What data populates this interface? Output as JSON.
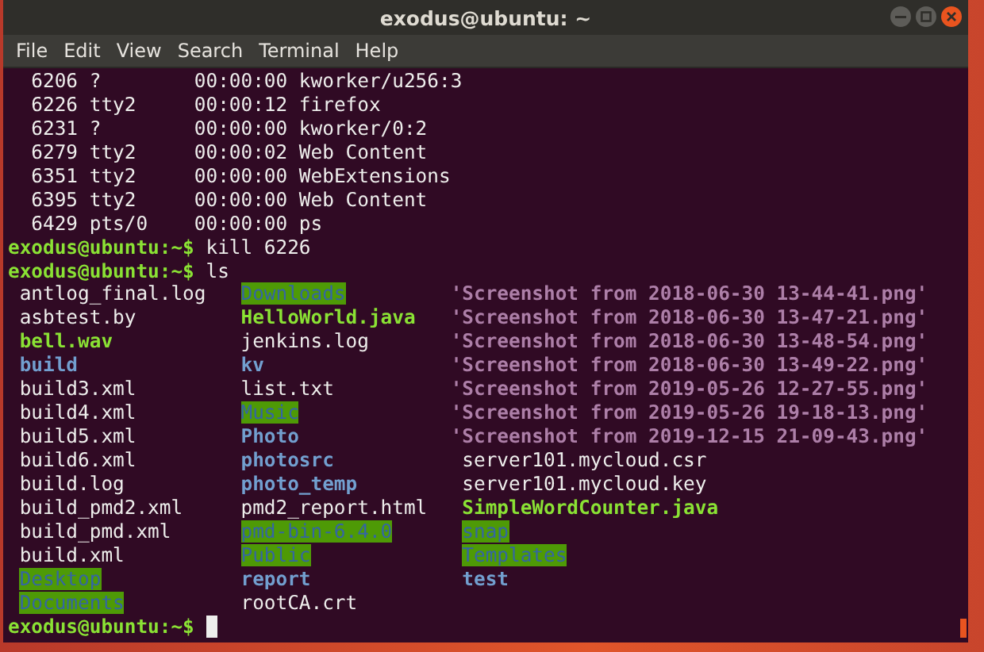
{
  "window": {
    "title": "exodus@ubuntu: ~"
  },
  "menu": [
    "File",
    "Edit",
    "View",
    "Search",
    "Terminal",
    "Help"
  ],
  "lines": [
    {
      "kind": "output",
      "text": "  6206 ?        00:00:00 kworker/u256:3"
    },
    {
      "kind": "output",
      "text": "  6226 tty2     00:00:12 firefox"
    },
    {
      "kind": "output",
      "text": "  6231 ?        00:00:00 kworker/0:2"
    },
    {
      "kind": "output",
      "text": "  6279 tty2     00:00:02 Web Content"
    },
    {
      "kind": "output",
      "text": "  6351 tty2     00:00:00 WebExtensions"
    },
    {
      "kind": "output",
      "text": "  6395 tty2     00:00:00 Web Content"
    },
    {
      "kind": "output",
      "text": "  6429 pts/0    00:00:00 ps"
    },
    {
      "kind": "prompt",
      "prompt": "exodus@ubuntu:~$",
      "command": "kill 6226"
    },
    {
      "kind": "prompt",
      "prompt": "exodus@ubuntu:~$",
      "command": "ls"
    }
  ],
  "ls_rows": [
    [
      {
        "name": "antlog_final.log",
        "kind": "file"
      },
      {
        "name": "Downloads",
        "kind": "shared-dir"
      },
      {
        "name": "'Screenshot from 2018-06-30 13-44-41.png'",
        "kind": "image"
      }
    ],
    [
      {
        "name": "asbtest.by",
        "kind": "file"
      },
      {
        "name": "HelloWorld.java",
        "kind": "exec"
      },
      {
        "name": "'Screenshot from 2018-06-30 13-47-21.png'",
        "kind": "image"
      }
    ],
    [
      {
        "name": "bell.wav",
        "kind": "exec"
      },
      {
        "name": "jenkins.log",
        "kind": "file"
      },
      {
        "name": "'Screenshot from 2018-06-30 13-48-54.png'",
        "kind": "image"
      }
    ],
    [
      {
        "name": "build",
        "kind": "dir"
      },
      {
        "name": "kv",
        "kind": "dir"
      },
      {
        "name": "'Screenshot from 2018-06-30 13-49-22.png'",
        "kind": "image"
      }
    ],
    [
      {
        "name": "build3.xml",
        "kind": "file"
      },
      {
        "name": "list.txt",
        "kind": "file"
      },
      {
        "name": "'Screenshot from 2019-05-26 12-27-55.png'",
        "kind": "image"
      }
    ],
    [
      {
        "name": "build4.xml",
        "kind": "file"
      },
      {
        "name": "Music",
        "kind": "shared-dir"
      },
      {
        "name": "'Screenshot from 2019-05-26 19-18-13.png'",
        "kind": "image"
      }
    ],
    [
      {
        "name": "build5.xml",
        "kind": "file"
      },
      {
        "name": "Photo",
        "kind": "dir"
      },
      {
        "name": "'Screenshot from 2019-12-15 21-09-43.png'",
        "kind": "image"
      }
    ],
    [
      {
        "name": "build6.xml",
        "kind": "file"
      },
      {
        "name": "photosrc",
        "kind": "dir"
      },
      {
        "name": "server101.mycloud.csr",
        "kind": "file"
      }
    ],
    [
      {
        "name": "build.log",
        "kind": "file"
      },
      {
        "name": "photo_temp",
        "kind": "dir"
      },
      {
        "name": "server101.mycloud.key",
        "kind": "file"
      }
    ],
    [
      {
        "name": "build_pmd2.xml",
        "kind": "file"
      },
      {
        "name": "pmd2_report.html",
        "kind": "file"
      },
      {
        "name": "SimpleWordCounter.java",
        "kind": "exec"
      }
    ],
    [
      {
        "name": "build_pmd.xml",
        "kind": "file"
      },
      {
        "name": "pmd-bin-6.4.0",
        "kind": "shared-dir"
      },
      {
        "name": "snap",
        "kind": "shared-dir"
      }
    ],
    [
      {
        "name": "build.xml",
        "kind": "file"
      },
      {
        "name": "Public",
        "kind": "shared-dir"
      },
      {
        "name": "Templates",
        "kind": "shared-dir"
      }
    ],
    [
      {
        "name": "Desktop",
        "kind": "shared-dir"
      },
      {
        "name": "report",
        "kind": "dir"
      },
      {
        "name": "test",
        "kind": "dir"
      }
    ],
    [
      {
        "name": "Documents",
        "kind": "shared-dir"
      },
      {
        "name": "rootCA.crt",
        "kind": "file"
      }
    ]
  ],
  "final_prompt": {
    "prompt": "exodus@ubuntu:~$"
  }
}
